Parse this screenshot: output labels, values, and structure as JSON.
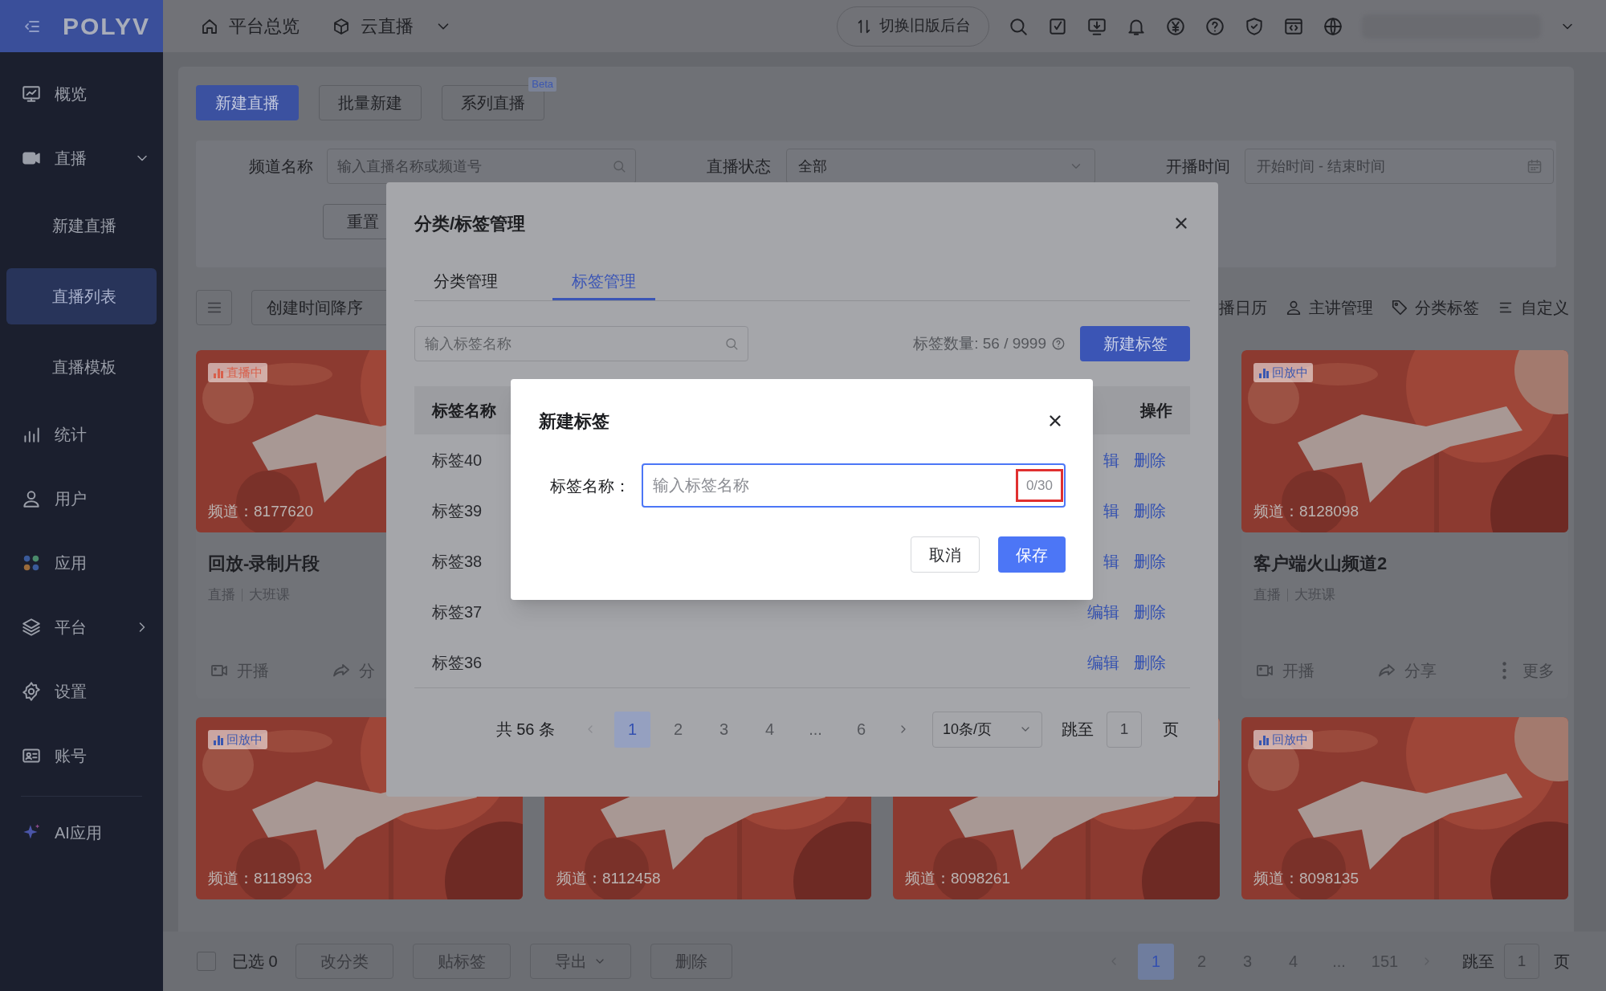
{
  "sidebar": {
    "logo": "POLYV",
    "items": [
      {
        "label": "概览",
        "selected": false
      },
      {
        "label": "直播",
        "selected": false,
        "expanded": true,
        "children": [
          {
            "label": "新建直播",
            "selected": false
          },
          {
            "label": "直播列表",
            "selected": true
          },
          {
            "label": "直播模板",
            "selected": false
          }
        ]
      },
      {
        "label": "统计",
        "selected": false
      },
      {
        "label": "用户",
        "selected": false
      },
      {
        "label": "应用",
        "selected": false
      },
      {
        "label": "平台",
        "selected": false,
        "expanded": false
      },
      {
        "label": "设置",
        "selected": false
      },
      {
        "label": "账号",
        "selected": false
      }
    ],
    "footer_items": [
      {
        "label": "AI应用",
        "selected": false
      }
    ]
  },
  "top_bar": {
    "nav": [
      {
        "label": "平台总览",
        "dropdown": false
      },
      {
        "label": "云直播",
        "dropdown": true
      }
    ],
    "switch_button": "切换旧版后台"
  },
  "create_buttons": [
    {
      "label": "新建直播",
      "primary": true
    },
    {
      "label": "批量新建",
      "primary": false
    },
    {
      "label": "系列直播",
      "primary": false,
      "badge": "Beta"
    }
  ],
  "filters": {
    "channel": {
      "label": "频道名称",
      "placeholder": "输入直播名称或频道号"
    },
    "status": {
      "label": "直播状态",
      "value": "全部"
    },
    "time": {
      "label": "开播时间",
      "placeholder": "开始时间 - 结束时间"
    },
    "reset": "重置"
  },
  "list_toolbar": {
    "sort": "创建时间降序",
    "links": [
      "播日历",
      "主讲管理",
      "分类标签",
      "自定义"
    ]
  },
  "cards": {
    "rows": [
      [
        {
          "badge": {
            "label": "直播中",
            "color": "#d8604c"
          },
          "channel": "频道：8177620",
          "title": "回放-录制片段",
          "tags": [
            "直播",
            "大班课"
          ],
          "actions": [
            "开播",
            "分"
          ]
        },
        "",
        "",
        {
          "badge": {
            "label": "回放中",
            "color": "#3a57b0"
          },
          "channel": "频道：8128098",
          "title": "客户端火山频道2",
          "tags": [
            "直播",
            "大班课"
          ],
          "actions": [
            "开播",
            "分享",
            "更多"
          ]
        }
      ],
      [
        {
          "badge": {
            "label": "回放中",
            "color": "#3a57b0"
          },
          "channel": "频道：8118963"
        },
        {
          "channel": "频道：8112458"
        },
        {
          "channel": "频道：8098261"
        },
        {
          "badge": {
            "label": "回放中",
            "color": "#3a57b0"
          },
          "channel": "频道：8098135"
        }
      ]
    ]
  },
  "bottom_bar": {
    "checked": false,
    "selected_count": "已选 0",
    "actions": [
      {
        "label": "改分类",
        "dropdown": false
      },
      {
        "label": "贴标签",
        "dropdown": false
      },
      {
        "label": "导出",
        "dropdown": true
      },
      {
        "label": "删除",
        "dropdown": false
      }
    ],
    "pagination": {
      "pages": [
        {
          "label": "1",
          "selected": true
        },
        {
          "label": "2",
          "selected": false
        },
        {
          "label": "3",
          "selected": false
        },
        {
          "label": "4",
          "selected": false
        },
        {
          "label": "...",
          "selected": false
        },
        {
          "label": "151",
          "selected": false
        }
      ],
      "jump_label": "跳至",
      "jump_value": "1",
      "page_unit": "页"
    }
  },
  "modal": {
    "title": "分类/标签管理",
    "tabs": [
      {
        "label": "分类管理",
        "selected": false
      },
      {
        "label": "标签管理",
        "selected": true
      }
    ],
    "search_placeholder": "输入标签名称",
    "count": "标签数量: 56 / 9999",
    "new_button": "新建标签",
    "columns": [
      "标签名称",
      "操作"
    ],
    "rows": [
      {
        "name": "标签40",
        "actions": [
          "辑",
          "删除"
        ]
      },
      {
        "name": "标签39",
        "actions": [
          "辑",
          "删除"
        ]
      },
      {
        "name": "标签38",
        "actions": [
          "辑",
          "删除"
        ]
      },
      {
        "name": "标签37",
        "actions": [
          "编辑",
          "删除"
        ]
      },
      {
        "name": "标签36",
        "actions": [
          "编辑",
          "删除"
        ]
      }
    ],
    "pagination": {
      "total": "共 56 条",
      "pages": [
        {
          "label": "1",
          "selected": true
        },
        {
          "label": "2",
          "selected": false
        },
        {
          "label": "3",
          "selected": false
        },
        {
          "label": "4",
          "selected": false
        },
        {
          "label": "...",
          "selected": false
        },
        {
          "label": "6",
          "selected": false
        }
      ],
      "page_size": "10条/页",
      "jump_label": "跳至",
      "jump_value": "1",
      "page_unit": "页"
    }
  },
  "dialog": {
    "title": "新建标签",
    "field_label": "标签名称：",
    "placeholder": "输入标签名称",
    "counter": "0/30",
    "buttons": [
      {
        "label": "取消",
        "primary": false
      },
      {
        "label": "保存",
        "primary": true
      }
    ]
  }
}
